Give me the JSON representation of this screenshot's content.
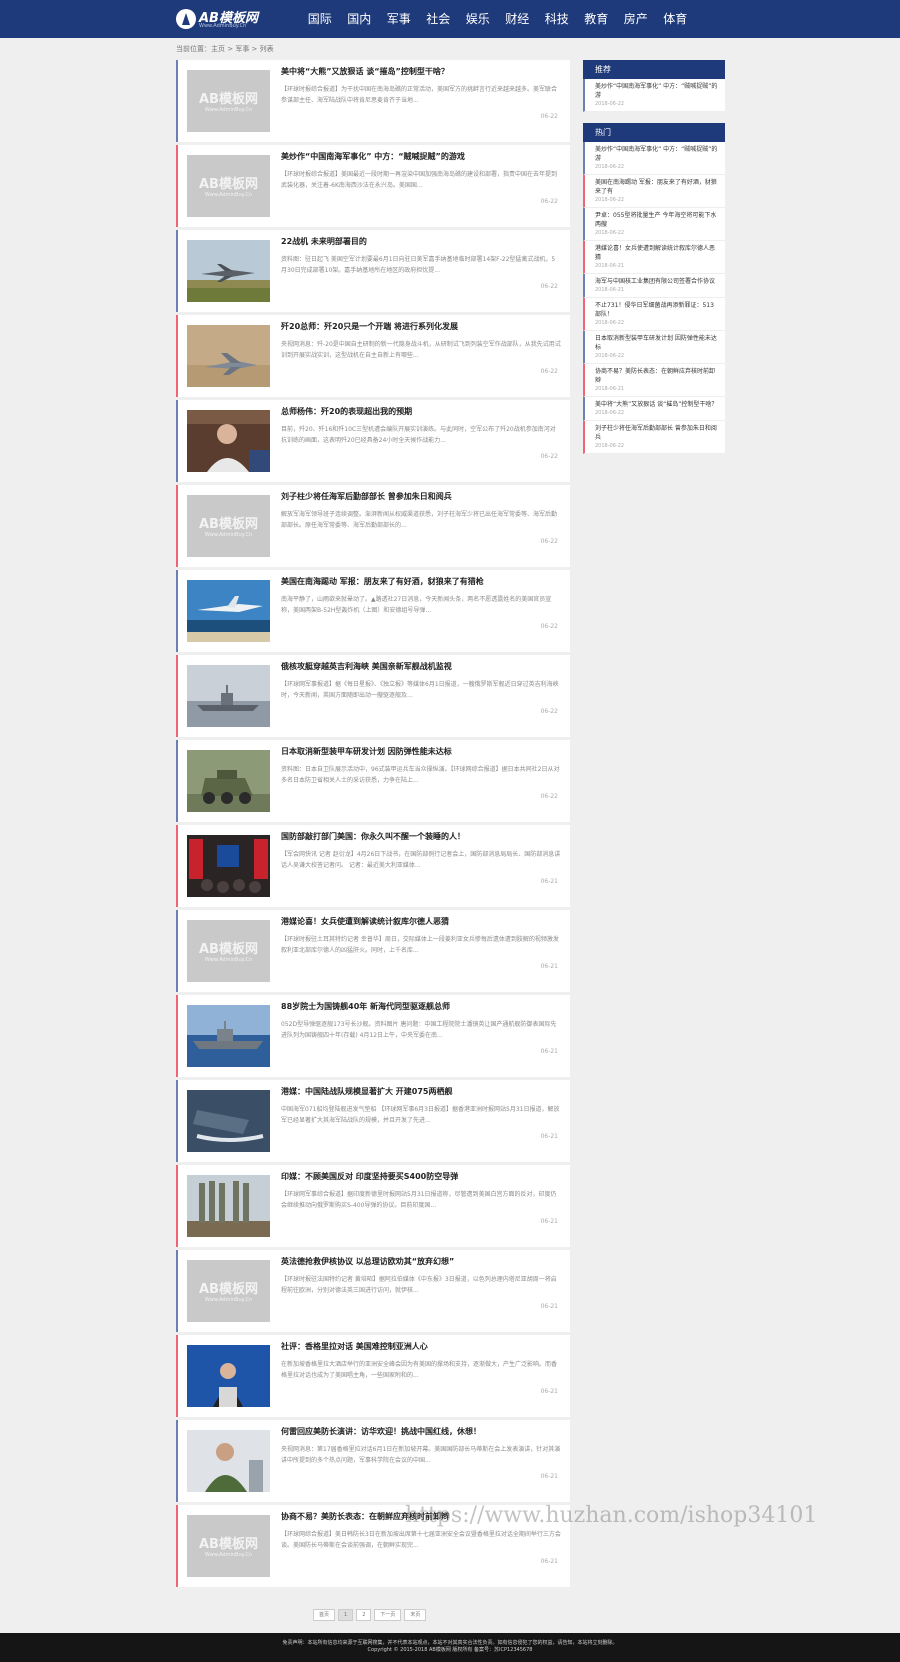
{
  "header": {
    "logo_title": "AB模板网",
    "logo_sub": "Www.AdminBuy.Cn",
    "nav": [
      "国际",
      "国内",
      "军事",
      "社会",
      "娱乐",
      "财经",
      "科技",
      "教育",
      "房产",
      "体育"
    ]
  },
  "breadcrumb": "当前位置：主页 > 军事 > 列表",
  "placeholder": {
    "title": "AB模板网",
    "sub": "Www.AdminBuy.Cn"
  },
  "articles": [
    {
      "title": "美中将“大熊”又放狠话 谈“摧岛”控制型干啥？",
      "desc": "【环球时报综合报道】为干扰中国在南海岛礁的正常活动，美国军方的挑衅言行近来越来越多。美军联合参谋部主任、海军陆战队中将肯尼思麦肯齐于当地...",
      "date": "06-22",
      "accent": "blue",
      "img": "ph"
    },
    {
      "title": "美炒作“中国南海军事化” 中方：“贼喊捉贼”的游戏",
      "desc": "【环球时报综合报道】美国最近一段时期一再渲染中国加强南海岛礁的建设和部署，指责中国在去年提到武装化器，关注着-6K南海西沙法在永兴岛。美国国...",
      "date": "06-22",
      "accent": "red",
      "img": "ph"
    },
    {
      "title": "22战机 未来明部署目的",
      "desc": "资料图：驻日起飞 美国空军计划要最6月1日向驻日美军嘉手纳基地临时部署14架F-22型猛禽式战机，5月30日完成部署10架。嘉手纳基地所在地区的政府担忧提...",
      "date": "06-22",
      "accent": "blue",
      "img": "jet"
    },
    {
      "title": "歼20总师：歼20只是一个开端 将进行系列化发展",
      "desc": "央视网消息：歼-20是中国自主研制的新一代隐身战斗机，从研制试飞到列装空军作战部队，从我先试用试训到开展实战实训，这型战机在自主自新上有哪些...",
      "date": "06-22",
      "accent": "red",
      "img": "jet2"
    },
    {
      "title": "总师杨伟：歼20的表现超出我的预期",
      "desc": "目前，歼20、歼16和歼10C三型机遭会编队开展实训演练。与此同时，空军公布了歼20战机参加南河对抗训练的画面，这表明歼20已经具备24小时全天候作战能力...",
      "date": "06-22",
      "accent": "blue",
      "img": "person"
    },
    {
      "title": "刘子柱少将任海军后勤部部长 曾参加朱日和阅兵",
      "desc": "解放军海军领导班子连续调整。澎湃新闻从权威渠道获悉，刘子柱海军少将已出任海军常委等、海军后勤部部长。原任海军常委等、海军后勤部部长的...",
      "date": "06-22",
      "accent": "red",
      "img": "ph"
    },
    {
      "title": "美国在南海踢动 军报：朋友来了有好酒，豺狼来了有猎枪",
      "desc": "南海平静了，山雨欲来就晕动了。▲路透社27日消息，今天新闻头条，两名不愿透露姓名的美国官员宣称，美国两架B-52H型轰炸机（上图）和安德组号导弹...",
      "date": "06-22",
      "accent": "blue",
      "img": "plane"
    },
    {
      "title": "俄核攻艇穿越英吉利海峡 美国亲新军舰战机监视",
      "desc": "【环球网军事报道】据《每日星报》、《独立报》等媒体6月1日报道，一艘俄罗斯军舰近日穿过英吉利海峡时，今天新闻，英国方面随即出动一艘驱逐舰及...",
      "date": "06-22",
      "accent": "red",
      "img": "ship"
    },
    {
      "title": "日本取消新型装甲车研发计划 因防弹性能未达标",
      "desc": "资料图：日本自卫队展示活动中，96式装甲运兵车当众操纵演。【环球网综合报道】据日本共同社2日从对多名日本防卫省相关人士的采访获悉，力争在陆上...",
      "date": "06-22",
      "accent": "blue",
      "img": "tank"
    },
    {
      "title": "国防部敲打部门美国：你永久叫不醒一个装睡的人！",
      "desc": "【军会网快讯 记者 赵衍龙】4月26日下战书，在国防部例行记者会上，国防部消息局局长、国防部消息讲话人吴谦大校答记者问。 记者：最近美大利亚媒体...",
      "date": "06-21",
      "accent": "red",
      "img": "press"
    },
    {
      "title": "港媒论喜！女兵使遭到解读统计叙库尔德人恶猜",
      "desc": "【环球时报驻土耳其特约记者 幸普华】周日，交际媒体上一段姜利亚女兵惨每后遗体遭到肢解的视频激发叙利亚北部库尔德人的凶猛肝火。同时，上千名库...",
      "date": "06-21",
      "accent": "blue",
      "img": "ph"
    },
    {
      "title": "88岁院士为国铸舰40年 新海代同型驱逐舰总师",
      "desc": "052D型导弹驱逐舰173号长沙舰。资料图片 唐问题：中国工程院院士潘镜英让国产通航舰防御表国际先进队列为国铸舰四十年(存载) 4月12日上午，中央军委在南...",
      "date": "06-21",
      "accent": "red",
      "img": "warship"
    },
    {
      "title": "港媒：中国陆战队规模显著扩大 开建075两栖舰",
      "desc": "中国海军071船均登陆舰进发气垫船 【环球网军事6月3日报道】据香港亚洲时报网站5月31日报道，解放军已经显著扩大其海军陆战队的规模，并且开发了先进...",
      "date": "06-21",
      "accent": "blue",
      "img": "hover"
    },
    {
      "title": "印媒：不顾美国反对 印度坚持要买S400防空导弹",
      "desc": "【环球网军事综合报道】据印度新德里时报网站5月31日报道称，尽管遭到美国白宫方面的反对，印度仍会继续推动向俄罗斯购买S-400导弹的协议。目前印度国...",
      "date": "06-21",
      "accent": "red",
      "img": "missile"
    },
    {
      "title": "英法德抢救伊核协议 以总理访欧劝其“放弃幻想”",
      "desc": "【环球时报驻法国特约记者 黄培昭】据阿拉伯媒体《中东报》3日报道，以色列总理内塔尼亚胡周一将启程前往欧洲，分别对德法英三国进行访问，就伊核...",
      "date": "06-21",
      "accent": "blue",
      "img": "ph"
    },
    {
      "title": "社评：香格里拉对话 美国难控制亚洲人心",
      "desc": "在新加坡香格里拉大酒店举行的亚洲安全峰会因为有美国的撑场和支持，逐渐做大，产生广泛影响。而香格里拉对话也成为了美国唱主角，一些国家附和的...",
      "date": "06-21",
      "accent": "red",
      "img": "speech"
    },
    {
      "title": "何雷回应美防长演讲：访华欢迎！挑战中国红线，休想！",
      "desc": "央视网消息：第17届香格里拉对话6月1日在新加坡开幕。美国国防部长马蒂斯在会上发表演讲，针对其演讲中所提到的多个热点问题，军事科学院在会议的中国...",
      "date": "06-21",
      "accent": "blue",
      "img": "officer"
    },
    {
      "title": "协商不易？美防长表态：在朝鲜应弃核时前卸辫",
      "desc": "【环球网综合报道】美日韩防长3日在新加坡出席第十七届亚洲安全会议暨香格里拉对话全期间举行三方会谈。美国防长马蒂斯在会谈前强调，在朝鲜实现完...",
      "date": "06-21",
      "accent": "red",
      "img": "ph"
    }
  ],
  "pager": [
    "首页",
    "1",
    "2",
    "下一页",
    "末页"
  ],
  "sidebar": {
    "recommend_title": "推荐",
    "recommend": [
      {
        "title": "美炒作“中国南海军事化” 中方：“贼喊捉贼”的游",
        "date": "2018-06-22",
        "accent": "blue"
      }
    ],
    "hot_title": "热门",
    "hot": [
      {
        "title": "美炒作“中国南海军事化” 中方：“贼喊捉贼”的游",
        "date": "2018-06-22",
        "accent": "blue"
      },
      {
        "title": "美国在南海踢动 军报：朋友来了有好酒，豺狼来了有",
        "date": "2018-06-22",
        "accent": "red"
      },
      {
        "title": "尹卓：055型将批量生产 今年海空将可能下水两艘",
        "date": "2018-06-22",
        "accent": "blue"
      },
      {
        "title": "港媒论喜！女兵使遭到解读统计叙库尔德人恶猜",
        "date": "2018-06-21",
        "accent": "red"
      },
      {
        "title": "海军与中国核工业集团有限公司签署合作协议",
        "date": "2018-06-21",
        "accent": "blue"
      },
      {
        "title": "不止731！侵华日军细菌战再添新罪证：513部队！",
        "date": "2018-06-22",
        "accent": "red"
      },
      {
        "title": "日本取消新型装甲车研发计划 因防弹性能未达标",
        "date": "2018-06-22",
        "accent": "blue"
      },
      {
        "title": "协商不易？美防长表态：在朝鲜应弃核时前卸辫",
        "date": "2018-06-21",
        "accent": "red"
      },
      {
        "title": "美中将“大熊”又放狠话 谈“摧岛”控制型干啥？",
        "date": "2018-06-22",
        "accent": "blue"
      },
      {
        "title": "刘子柱少将任海军后勤部部长 曾参加朱日和阅兵",
        "date": "2018-06-22",
        "accent": "red"
      }
    ]
  },
  "watermark": "https://www.huzhan.com/ishop34101",
  "footer": {
    "line1": "免责声明：本站所有信息均来源于互联网搜集，并不代表本站观点，本站不对其真实合法性负责。如有信息侵犯了您的权益，请告知，本站将立刻删除。",
    "line2": "Copyright © 2015-2018 AB模板网 版权所有  备案号：苏ICP12345678"
  },
  "colors": {
    "brand": "#1f3a7a",
    "accent_blue": "#6e7fb3",
    "accent_red": "#f06473"
  }
}
